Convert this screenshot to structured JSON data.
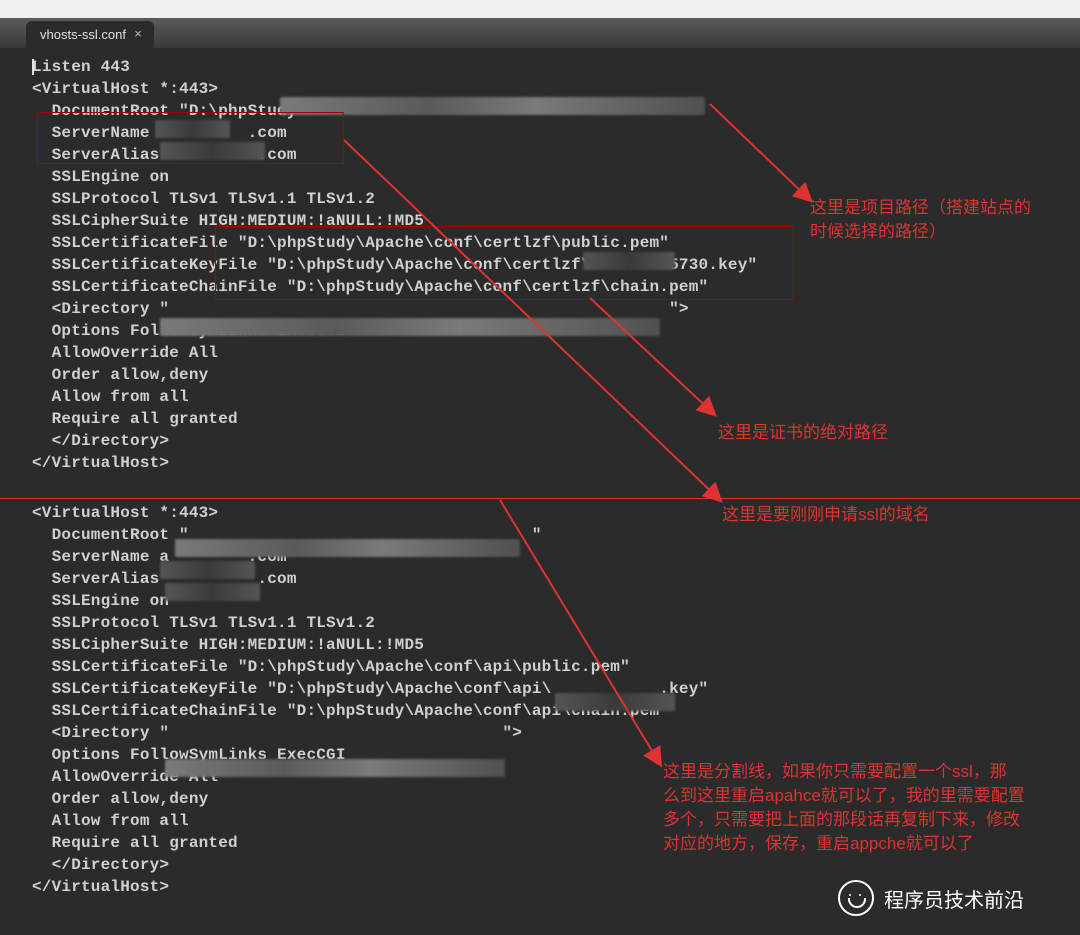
{
  "tab": {
    "title": "vhosts-ssl.conf",
    "close_glyph": "×"
  },
  "code": {
    "l1": "Listen 443",
    "l2": "<VirtualHost *:443>",
    "l3": "  DocumentRoot \"D:\\phpStudy",
    "l4": "  ServerName          .com",
    "l5": "  ServerAlias          .com",
    "l6": "  SSLEngine on",
    "l7": "  SSLProtocol TLSv1 TLSv1.1 TLSv1.2",
    "l8": "  SSLCipherSuite HIGH:MEDIUM:!aNULL:!MD5",
    "l9": "  SSLCertificateFile \"D:\\phpStudy\\Apache\\conf\\certlzf\\public.pem\"",
    "l10": "  SSLCertificateKeyFile \"D:\\phpStudy\\Apache\\conf\\certlzf\\        5730.key\"",
    "l11": "  SSLCertificateChainFile \"D:\\phpStudy\\Apache\\conf\\certlzf\\chain.pem\"",
    "l12": "",
    "l13": "  <Directory \"                                                   \">",
    "l14": "  Options FollowSymLinks ExecCGI",
    "l15": "  AllowOverride All",
    "l16": "  Order allow,deny",
    "l17": "  Allow from all",
    "l18": "  Require all granted",
    "l19": "  </Directory>",
    "l20": "</VirtualHost>",
    "m1": "<VirtualHost *:443>",
    "m2": "  DocumentRoot \"                                   \"",
    "m3": "  ServerName a        .com",
    "m4": "  ServerAlias          .com",
    "m5": "  SSLEngine on",
    "m6": "  SSLProtocol TLSv1 TLSv1.1 TLSv1.2",
    "m7": "  SSLCipherSuite HIGH:MEDIUM:!aNULL:!MD5",
    "m8": "  SSLCertificateFile \"D:\\phpStudy\\Apache\\conf\\api\\public.pem\"",
    "m9": "  SSLCertificateKeyFile \"D:\\phpStudy\\Apache\\conf\\api\\           .key\"",
    "m10": "  SSLCertificateChainFile \"D:\\phpStudy\\Apache\\conf\\api\\chain.pem\"",
    "m11": "",
    "m12": "  <Directory \"                                  \">",
    "m13": "  Options FollowSymLinks ExecCGI",
    "m14": "  AllowOverride All",
    "m15": "  Order allow,deny",
    "m16": "  Allow from all",
    "m17": "  Require all granted",
    "m18": "  </Directory>",
    "m19": "</VirtualHost>"
  },
  "annotations": {
    "a1": "这里是项目路径（搭建站点的\n时候选择的路径）",
    "a2": "这里是证书的绝对路径",
    "a3": "这里是要刚刚申请ssl的域名",
    "a4": "这里是分割线，如果你只需要配置一个ssl，那\n么到这里重启apahce就可以了，我的里需要配置\n多个，只需要把上面的那段话再复制下来，修改\n对应的地方，保存，重启appche就可以了"
  },
  "watermark": "程序员技术前沿"
}
